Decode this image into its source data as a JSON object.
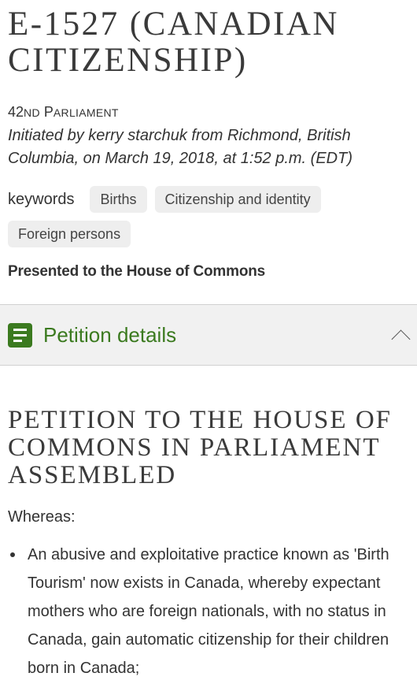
{
  "petition": {
    "title": "E-1527 (CANADIAN CITIZENSHIP)",
    "parliament_number": "42ND",
    "parliament_word": "PARLIAMENT",
    "initiated": "Initiated by kerry starchuk from Richmond, British Columbia, on March 19, 2018, at 1:52 p.m. (EDT)",
    "keywords_label": "keywords",
    "keywords": [
      "Births",
      "Citizenship and identity",
      "Foreign persons"
    ],
    "status": "Presented to the House of Commons"
  },
  "details": {
    "label": "Petition details",
    "icon": "document-icon",
    "toggle_icon": "chevron-up-icon",
    "accent": "#3b7a1f"
  },
  "content": {
    "heading": "PETITION TO THE HOUSE OF COMMONS IN PARLIAMENT ASSEMBLED",
    "whereas": "Whereas:",
    "bullets": [
      "An abusive and exploitative practice known as 'Birth Tourism' now exists in Canada, whereby expectant mothers who are foreign nationals, with no status in Canada, gain automatic citizenship for their children born in Canada;"
    ]
  }
}
